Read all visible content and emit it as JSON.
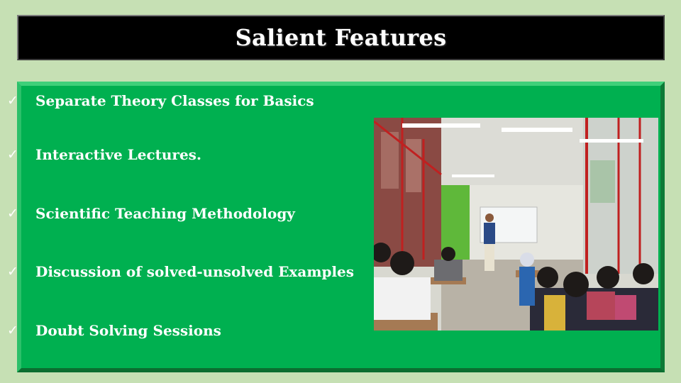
{
  "slide": {
    "title": "Salient Features",
    "features": [
      {
        "label": "Separate Theory Classes for Basics",
        "icon": "checkmark-icon"
      },
      {
        "label": "Interactive Lectures.",
        "icon": "checkmark-icon"
      },
      {
        "label": "Scientific Teaching Methodology",
        "icon": "checkmark-icon"
      },
      {
        "label": "Discussion of solved-unsolved Examples",
        "icon": "checkmark-icon"
      },
      {
        "label": "Doubt Solving Sessions",
        "icon": "checkmark-icon"
      }
    ],
    "check_glyph": "✓",
    "colors": {
      "background": "#c6e0b4",
      "title_bar": "#000000",
      "panel": "#00b050",
      "text": "#ffffff"
    }
  }
}
